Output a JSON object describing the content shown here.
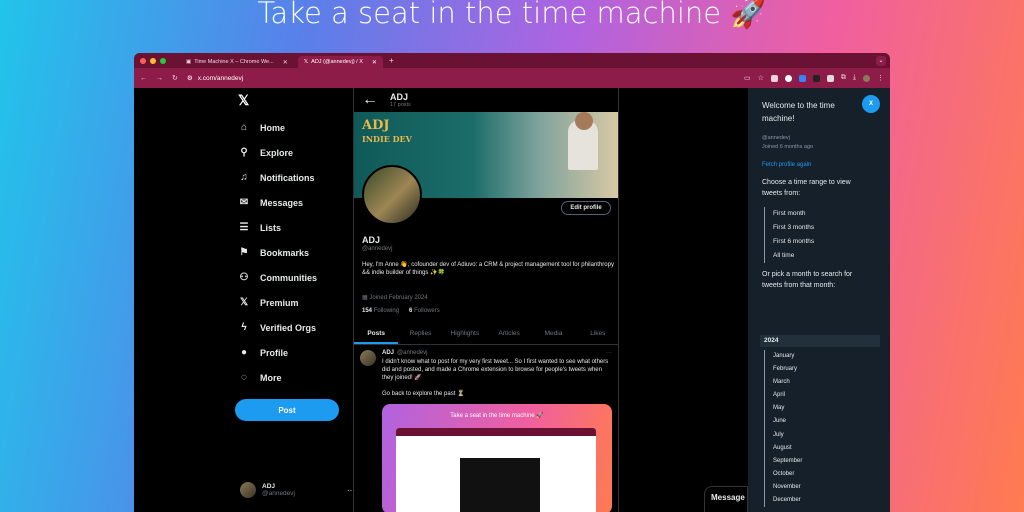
{
  "headline": "Take a seat in the time machine 🚀",
  "browser": {
    "dot_colors": [
      "#ff5f57",
      "#febc2e",
      "#28c840"
    ],
    "tabs": [
      {
        "label": "Time Machine X – Chrome We...",
        "active": false
      },
      {
        "label": "ADJ (@annedevj) / X",
        "active": true
      }
    ],
    "url": "x.com/annedevj"
  },
  "nav": {
    "items": [
      {
        "label": "Home",
        "icon": "home-icon"
      },
      {
        "label": "Explore",
        "icon": "search-icon"
      },
      {
        "label": "Notifications",
        "icon": "bell-icon"
      },
      {
        "label": "Messages",
        "icon": "mail-icon"
      },
      {
        "label": "Lists",
        "icon": "list-icon"
      },
      {
        "label": "Bookmarks",
        "icon": "bookmark-icon"
      },
      {
        "label": "Communities",
        "icon": "people-icon"
      },
      {
        "label": "Premium",
        "icon": "x-logo-icon"
      },
      {
        "label": "Verified Orgs",
        "icon": "lightning-icon"
      },
      {
        "label": "Profile",
        "icon": "person-icon"
      },
      {
        "label": "More",
        "icon": "more-circle-icon"
      }
    ],
    "post_label": "Post",
    "account": {
      "name": "ADJ",
      "handle": "@annedevj"
    }
  },
  "profile": {
    "name": "ADJ",
    "post_count": "17 posts",
    "banner_title": "ADJ",
    "banner_subtitle": "INDIE DEV",
    "edit_label": "Edit profile",
    "handle": "@annedevj",
    "bio_line1": "Hey, I'm Anne 👋, cofounder dev of Adiuvo: a CRM & project management tool for philanthropy",
    "bio_line2": "&& indie builder of things ✨🍀",
    "joined": "Joined February 2024",
    "following_count": "154",
    "following_label": "Following",
    "followers_count": "6",
    "followers_label": "Followers",
    "tabs": [
      "Posts",
      "Replies",
      "Highlights",
      "Articles",
      "Media",
      "Likes"
    ]
  },
  "tweet": {
    "name": "ADJ",
    "handle": "@annedevj",
    "text1": "I didn't know what to post for my very first tweet... So I first wanted to see what others did and posted, and made a Chrome extension to browse for people's tweets when they joined! 🚀",
    "text2": "Go back to explore the past ⏳",
    "image_caption": "Take a seat in the time machine 🚀"
  },
  "messages_label": "Message",
  "panel": {
    "title": "Welcome to the time machine!",
    "close_label": "X",
    "handle": "@annedevj",
    "joined": "Joined 6 months ago",
    "fetch_label": "Fetch profile again",
    "range_prompt": "Choose a time range to view tweets from:",
    "ranges": [
      "First month",
      "First 3 months",
      "First 6 months",
      "All time"
    ],
    "month_prompt": "Or pick a month to search for tweets from that month:",
    "year": "2024",
    "months": [
      "January",
      "February",
      "March",
      "April",
      "May",
      "June",
      "July",
      "August",
      "September",
      "October",
      "November",
      "December"
    ]
  }
}
